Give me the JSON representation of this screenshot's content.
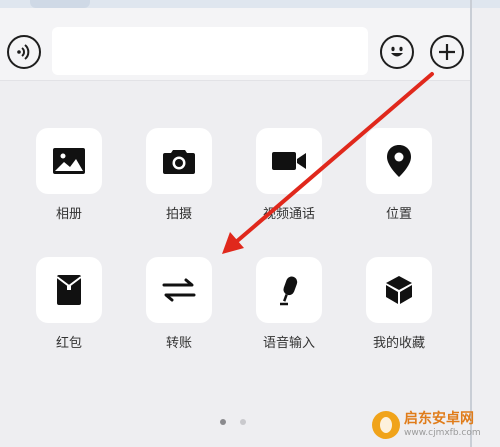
{
  "input_bar": {
    "voice_icon": "voice-wave-icon",
    "emoji_icon": "smiley-icon",
    "plus_icon": "plus-circle-icon",
    "text_value": ""
  },
  "panel": {
    "items": [
      {
        "label": "相册",
        "icon": "image-icon"
      },
      {
        "label": "拍摄",
        "icon": "camera-icon"
      },
      {
        "label": "视频通话",
        "icon": "video-camera-icon"
      },
      {
        "label": "位置",
        "icon": "location-pin-icon"
      },
      {
        "label": "红包",
        "icon": "red-envelope-icon"
      },
      {
        "label": "转账",
        "icon": "transfer-arrows-icon"
      },
      {
        "label": "语音输入",
        "icon": "microphone-icon"
      },
      {
        "label": "我的收藏",
        "icon": "cube-icon"
      }
    ],
    "page_dots": {
      "count": 2,
      "active_index": 0
    },
    "active_dot_color": "#8a8a8e",
    "inactive_dot_color": "#c9c9cd"
  },
  "annotation": {
    "arrow_color": "#e0281c"
  },
  "watermark": {
    "title": "启东安卓网",
    "url": "www.cjmxfb.com"
  }
}
